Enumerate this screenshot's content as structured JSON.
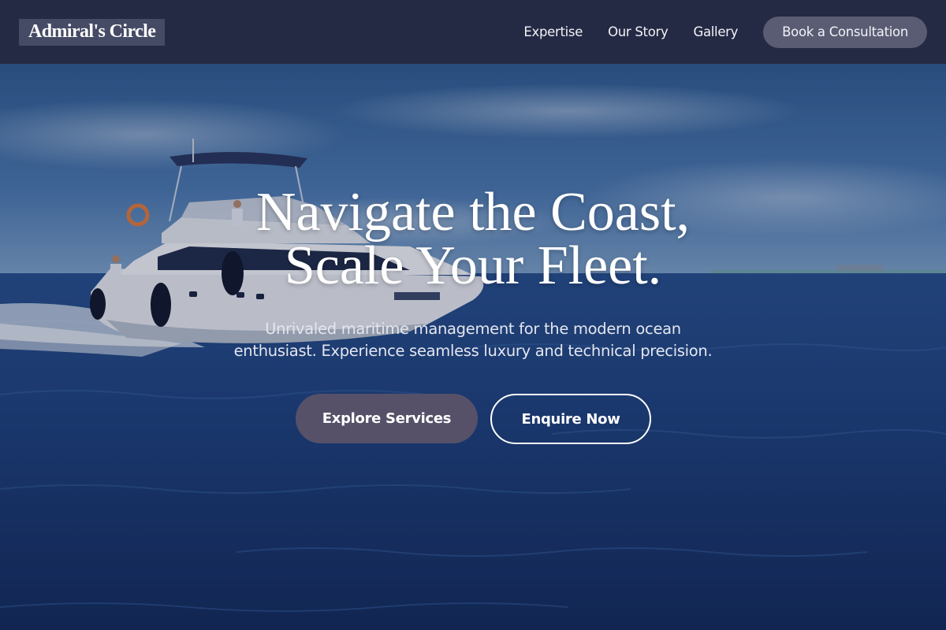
{
  "header": {
    "logo": "Admiral's Circle",
    "nav": [
      "Expertise",
      "Our Story",
      "Gallery"
    ],
    "cta": "Book a Consultation"
  },
  "hero": {
    "headline_line1": "Navigate the Coast,",
    "headline_line2": "Scale Your Fleet.",
    "subtitle_line1": "Unrivaled maritime management for the modern ocean",
    "subtitle_line2": "enthusiast. Experience seamless luxury and technical precision.",
    "primary_button": "Explore Services",
    "secondary_button": "Enquire Now",
    "background_image": "yacht-on-ocean"
  },
  "colors": {
    "nav_bg": "#252a44",
    "logo_bg": "#454a65",
    "cta_bg": "#5a5c74",
    "primary_btn_bg": "#565169",
    "ocean": "#1c3f7a"
  }
}
